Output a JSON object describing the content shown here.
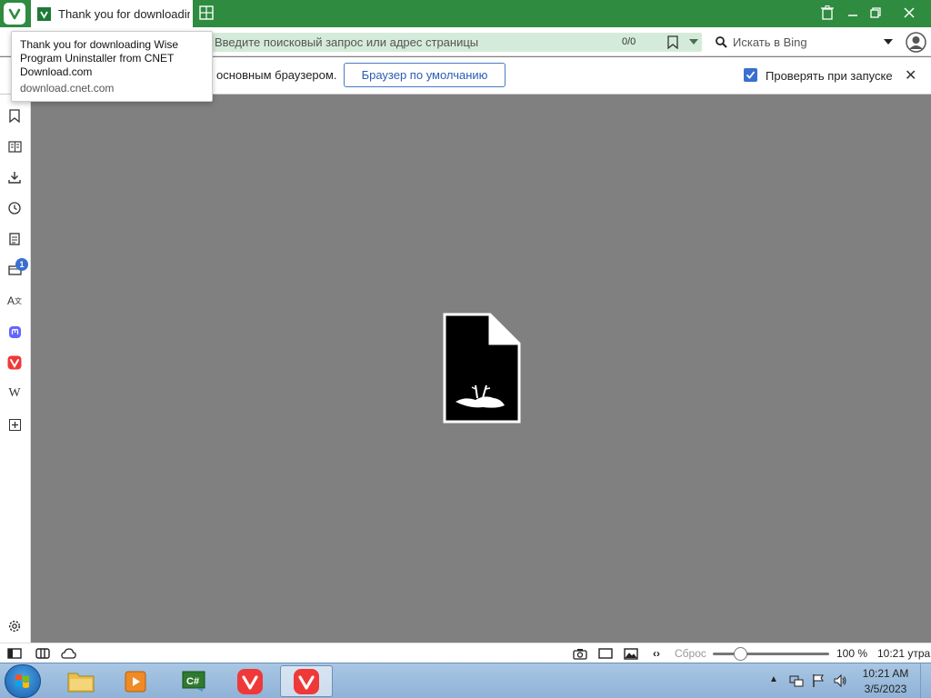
{
  "tabs": {
    "active_title": "Thank you for downloading",
    "active_favicon": "CNET download favicon"
  },
  "address_bar": {
    "url_placeholder": "Введите поисковый запрос или адрес страницы",
    "find_counter": "0/0",
    "search_placeholder": "Искать в Bing"
  },
  "notification": {
    "text": "основным браузером.",
    "default_button": "Браузер по умолчанию",
    "check_label": "Проверять при запуске",
    "check_checked": true
  },
  "tooltip": {
    "title": "Thank you for downloading Wise Program Uninstaller from CNET Download.com",
    "url": "download.cnet.com"
  },
  "panel": {
    "badge": "1",
    "items": [
      "bookmark-icon",
      "reading-list-icon",
      "download-icon",
      "history-icon",
      "notes-icon",
      "window-panel-icon",
      "translate-icon",
      "mastodon-icon",
      "vivaldi-icon",
      "wikipedia-icon",
      "add-panel-icon",
      "settings-icon"
    ]
  },
  "statusbar": {
    "reset_label": "Сброс",
    "zoom_percent": 100,
    "zoom": "100 %",
    "clock": "10:21 утра"
  },
  "taskbar": {
    "time": "10:21 AM",
    "date": "3/5/2023"
  },
  "colors": {
    "accent": "#2e8b3f",
    "content_bg": "#808080",
    "link_blue": "#3a6fcf"
  }
}
